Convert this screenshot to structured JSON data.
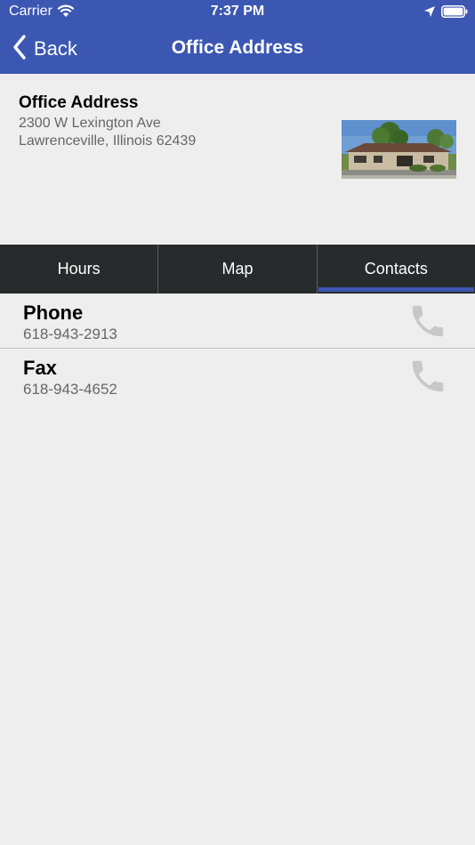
{
  "status_bar": {
    "carrier": "Carrier",
    "time": "7:37 PM"
  },
  "nav": {
    "back_label": "Back",
    "title": "Office Address"
  },
  "address": {
    "title": "Office Address",
    "line1": "2300 W Lexington Ave",
    "line2": "Lawrenceville, Illinois 62439"
  },
  "tabs": [
    {
      "label": "Hours"
    },
    {
      "label": "Map"
    },
    {
      "label": "Contacts"
    }
  ],
  "contacts": [
    {
      "label": "Phone",
      "number": "618-943-2913"
    },
    {
      "label": "Fax",
      "number": "618-943-4652"
    }
  ],
  "colors": {
    "accent": "#3b57b2",
    "tab_bar": "#272b2b",
    "background": "#eeeeee",
    "icon_gray": "#c8c8c8"
  },
  "icons": {
    "wifi": "wifi-icon",
    "location": "location-arrow-icon",
    "battery": "battery-icon",
    "back": "chevron-left-icon",
    "call": "phone-icon"
  }
}
